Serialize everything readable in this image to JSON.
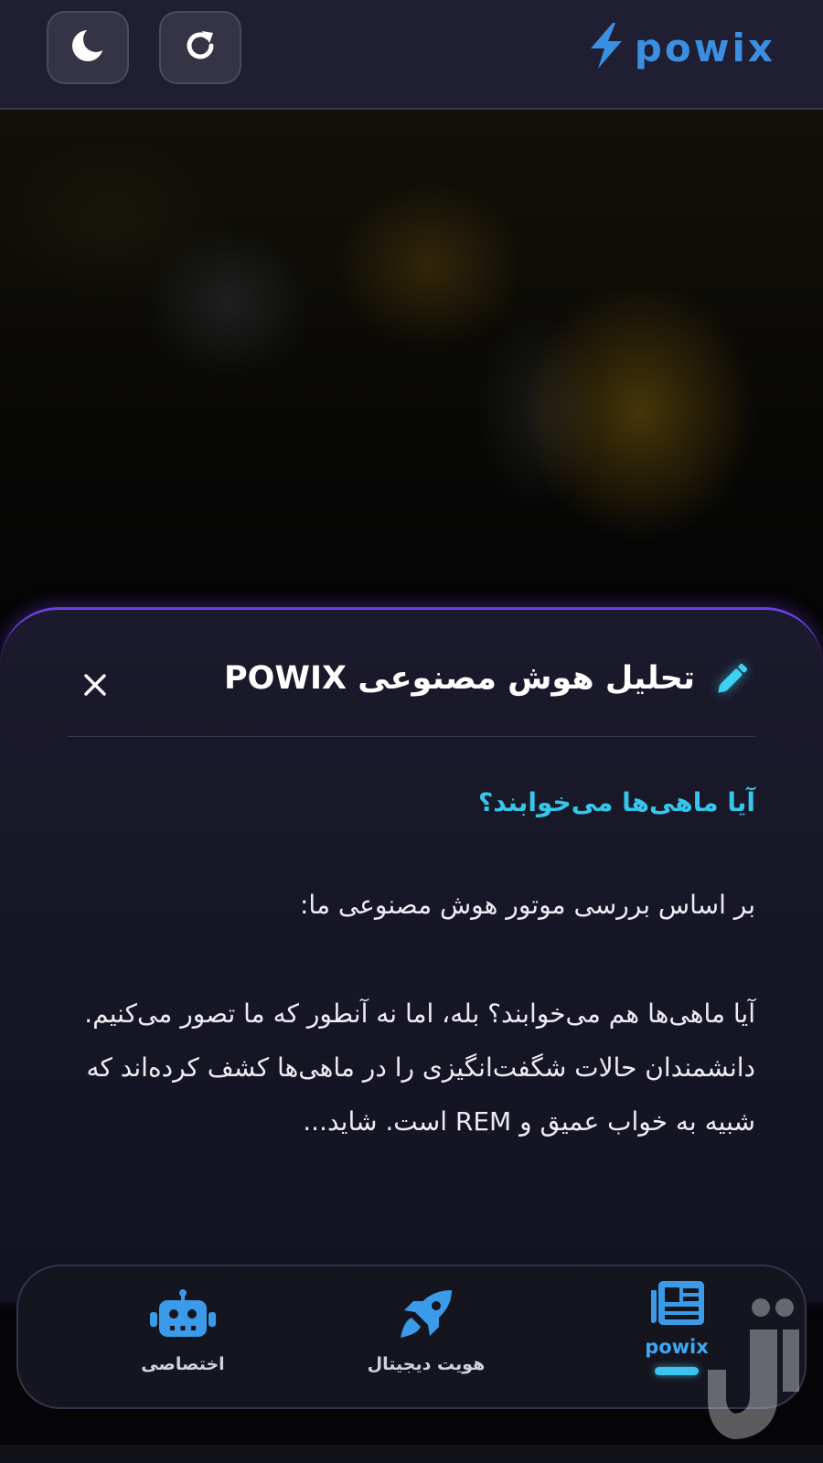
{
  "header": {
    "brand_name": "powix",
    "theme_toggle_icon": "moon-icon",
    "refresh_icon": "refresh-icon",
    "brand_icon": "lightning-bolt-icon"
  },
  "sheet": {
    "title": "تحلیل هوش مصنوعی POWIX",
    "title_icon": "pencil-icon",
    "close_icon": "close-icon",
    "question": "آیا ماهی‌ها می‌خوابند؟",
    "intro": "بر اساس بررسی موتور هوش مصنوعی ما:",
    "answer": "آیا ماهی‌ها هم می‌خوابند؟ بله، اما نه آنطور که ما تصور می‌کنیم. دانشمندان حالات شگفت‌انگیزی را در ماهی‌ها کشف کرده‌اند که شبیه به خواب عمیق و REM است. شاید..."
  },
  "bottom_nav": {
    "items": [
      {
        "label": "powix",
        "icon": "newspaper-icon",
        "active": true
      },
      {
        "label": "هویت دیجیتال",
        "icon": "rocket-icon",
        "active": false
      },
      {
        "label": "اختصاصی",
        "icon": "robot-icon",
        "active": false
      }
    ]
  },
  "colors": {
    "accent_blue": "#3b8fe0",
    "accent_cyan": "#35c6e9",
    "sheet_border_purple": "#6c3fe0",
    "header_bg": "#1f1e32"
  }
}
